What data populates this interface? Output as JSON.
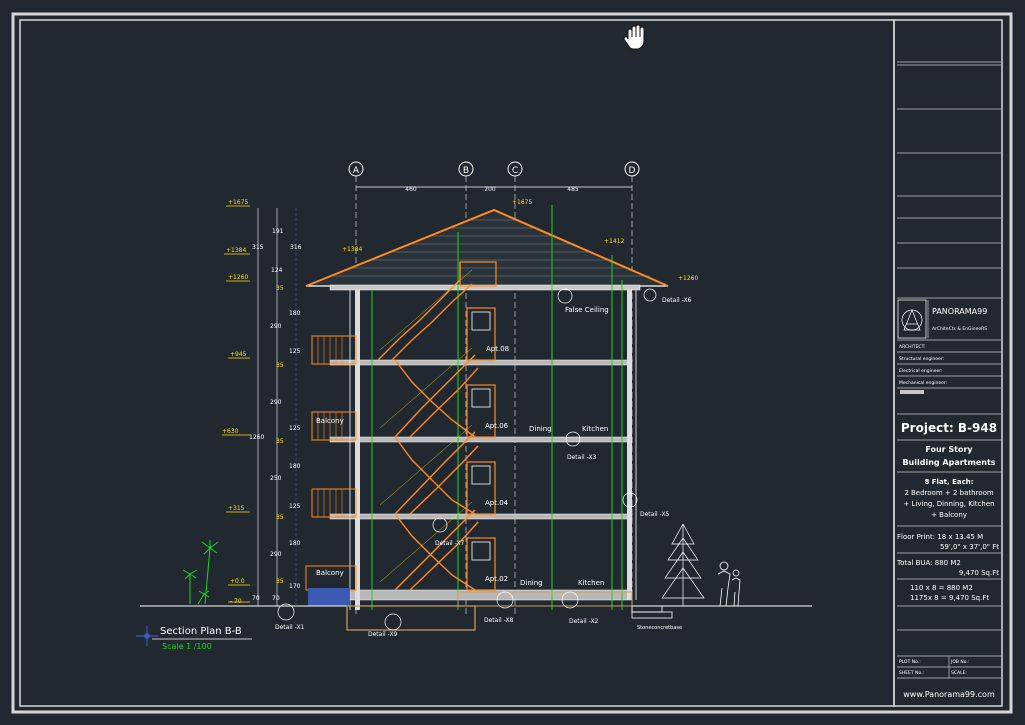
{
  "cursor": {
    "icon": "hand-pan-icon"
  },
  "axis_labels": [
    "A",
    "B",
    "C",
    "D"
  ],
  "axis_dims": [
    "460",
    "200",
    "485"
  ],
  "elev_labels": [
    "+1675",
    "+1384",
    "+1260",
    "+945",
    "+630",
    "+315",
    "+0.0",
    "- 70",
    "+1675",
    "+1384",
    "+1412",
    "+1260"
  ],
  "vert_dims": [
    "191",
    "315",
    "316",
    "124",
    "290",
    "180",
    "125",
    "290",
    "1260",
    "125",
    "180",
    "250",
    "125",
    "180",
    "290",
    "170",
    "70",
    "70",
    "35",
    "35",
    "35",
    "35",
    "35"
  ],
  "room_labels": {
    "false_ceiling": "False Ceiling",
    "apt08": "Apt.08",
    "apt06": "Apt.06",
    "apt04": "Apt.04",
    "apt02": "Apt.02",
    "dining1": "Dining",
    "kitchen1": "Kitchen",
    "dining2": "Dining",
    "kitchen2": "Kitchen",
    "balcony1": "Balcony",
    "balcony2": "Balcony"
  },
  "details": [
    "Detail -X6",
    "Detail -X3",
    "Detail -X5",
    "Detail -X7",
    "Detail -X1",
    "Detail -X9",
    "Detail -X8",
    "Detail -X2"
  ],
  "foundation_note": "Stoneconcretbase",
  "section_title": "Section Plan B-B",
  "section_scale": "Scale 1 /100",
  "title_block": {
    "brand": "PANORAMA99",
    "brand_sub": "ArChiteCts & EnGineeRS",
    "architect": "ARCHITECT:",
    "structural": "Structural engineer:",
    "electrical": "Electrical engineer:",
    "mechanical": "Mechanical engineer:",
    "project": "Project: B-948",
    "building_line1": "Four Story",
    "building_line2": "Building Apartments",
    "flat_line1": "8 Flat, Each:",
    "flat_line2": "2 Bedroom + 2 bathroom",
    "flat_line3": "+ Living, Dinning, Kitchen",
    "flat_line4": "+ Balcony",
    "floor_print_1": "Floor Print:  18 x 13.45 M",
    "floor_print_2": "59',0\" x 37',0\" Ft",
    "bua_1": "Total BUA:  880     M2",
    "bua_2": "9,470 Sq.Ft",
    "calc_1": "110  x 8 = 880     M2",
    "calc_2": "1175x 8 = 9,470 Sq.Ft",
    "plot_no": "PLOT No.:",
    "job_no": "JOB No.:",
    "sheet_no": "SHEET No.:",
    "scale": "SCALE:",
    "website": "www.Panorama99.com"
  },
  "colors": {
    "background": "#212830",
    "line": "#ffffff",
    "orange": "#ff8a1e",
    "green": "#18d818",
    "yellow": "#ffe100",
    "blue": "#3c5ab4",
    "ground": "#c8a064"
  }
}
